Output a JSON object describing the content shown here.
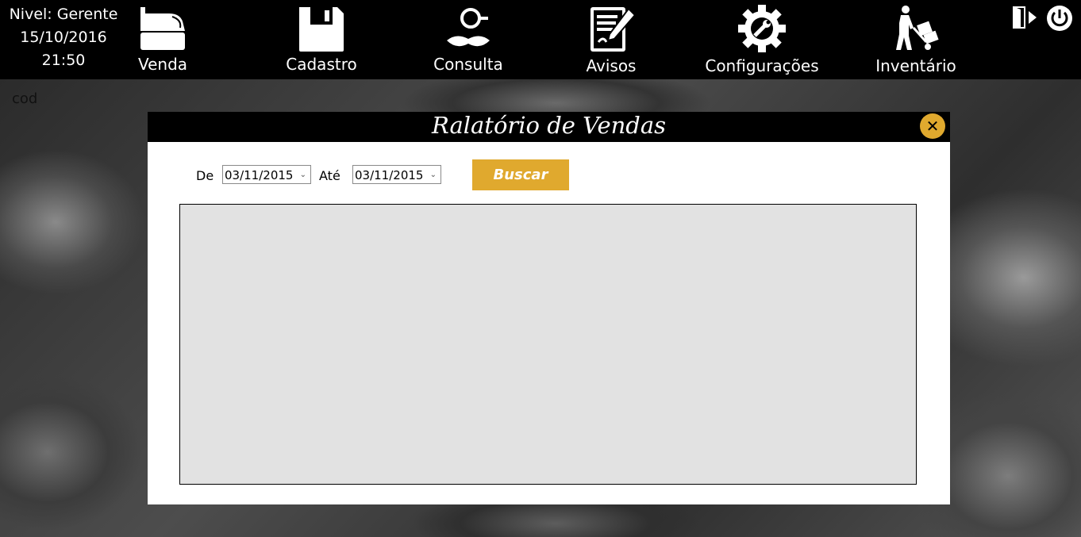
{
  "status": {
    "level": "Nivel: Gerente",
    "date": "15/10/2016",
    "time": "21:50"
  },
  "nav": [
    {
      "label": "Venda",
      "icon": "cash-register-icon"
    },
    {
      "label": "Cadastro",
      "icon": "floppy-disk-icon"
    },
    {
      "label": "Consulta",
      "icon": "detective-icon"
    },
    {
      "label": "Avisos",
      "icon": "notepad-pen-icon"
    },
    {
      "label": "Configurações",
      "icon": "gear-wrench-icon"
    },
    {
      "label": "Inventário",
      "icon": "hand-truck-icon"
    }
  ],
  "top_actions": [
    {
      "icon": "logout-icon"
    },
    {
      "icon": "power-icon"
    }
  ],
  "cod_label": "cod",
  "dialog": {
    "title": "Ralatório de Vendas",
    "close_icon": "close-icon",
    "from_label": "De",
    "from_value": "03/11/2015",
    "to_label": "Até",
    "to_value": "03/11/2015",
    "search_button": "Buscar"
  },
  "colors": {
    "accent": "#e0a92e",
    "topbar": "#000000",
    "grid": "#e2e2e2"
  }
}
